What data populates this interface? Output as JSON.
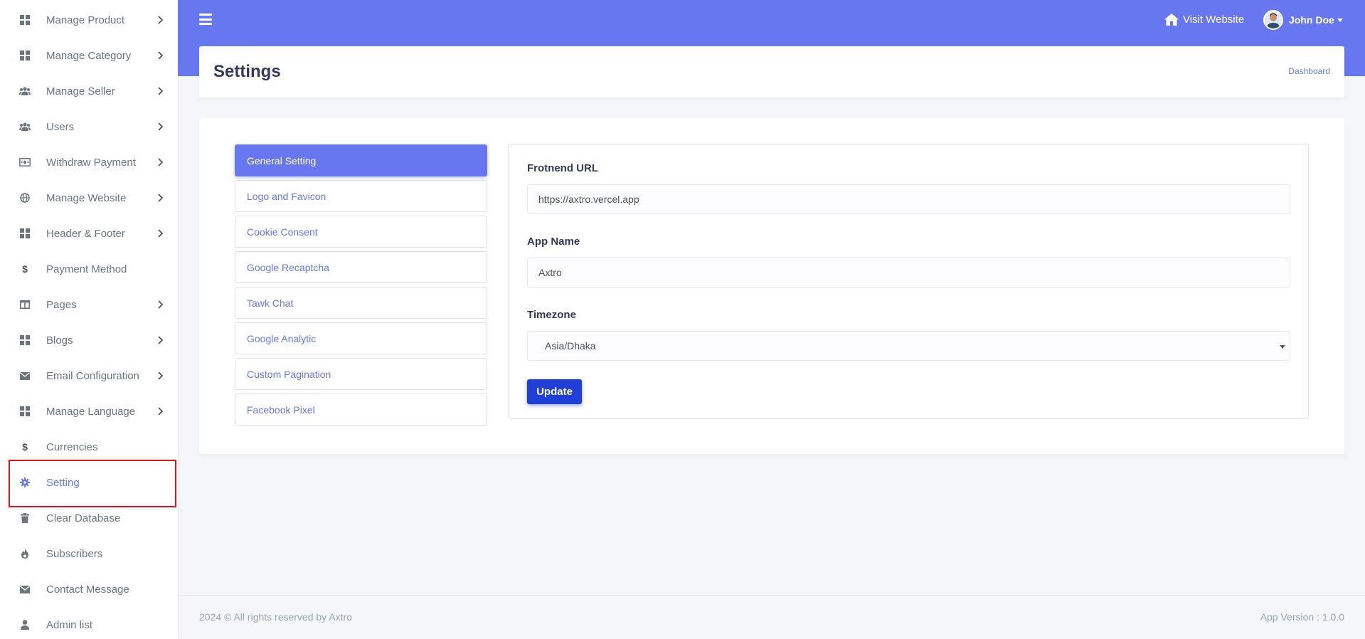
{
  "sidebar": {
    "items": [
      {
        "label": "Manage Product",
        "icon": "grid-icon",
        "chevron": true
      },
      {
        "label": "Manage Category",
        "icon": "grid-icon",
        "chevron": true
      },
      {
        "label": "Manage Seller",
        "icon": "users-icon",
        "chevron": true
      },
      {
        "label": "Users",
        "icon": "users-icon",
        "chevron": true
      },
      {
        "label": "Withdraw Payment",
        "icon": "money-card-icon",
        "chevron": true
      },
      {
        "label": "Manage Website",
        "icon": "globe-icon",
        "chevron": true
      },
      {
        "label": "Header & Footer",
        "icon": "grid-icon",
        "chevron": true
      },
      {
        "label": "Payment Method",
        "icon": "dollar-icon",
        "chevron": false
      },
      {
        "label": "Pages",
        "icon": "columns-icon",
        "chevron": true
      },
      {
        "label": "Blogs",
        "icon": "grid-icon",
        "chevron": true
      },
      {
        "label": "Email Configuration",
        "icon": "envelope-icon",
        "chevron": true
      },
      {
        "label": "Manage Language",
        "icon": "grid-icon",
        "chevron": true
      },
      {
        "label": "Currencies",
        "icon": "dollar-icon",
        "chevron": false
      },
      {
        "label": "Setting",
        "icon": "gear-icon",
        "chevron": false,
        "active": true
      },
      {
        "label": "Clear Database",
        "icon": "trash-icon",
        "chevron": false
      },
      {
        "label": "Subscribers",
        "icon": "fire-icon",
        "chevron": false
      },
      {
        "label": "Contact Message",
        "icon": "envelope-icon",
        "chevron": false
      },
      {
        "label": "Admin list",
        "icon": "user-icon",
        "chevron": false
      }
    ]
  },
  "topbar": {
    "menu_icon": "hamburger-icon",
    "visit_website": "Visit Website",
    "user_name": "John Doe"
  },
  "header": {
    "title": "Settings",
    "breadcrumb": "Dashboard"
  },
  "settings_tabs": [
    {
      "label": "General Setting",
      "active": true
    },
    {
      "label": "Logo and Favicon"
    },
    {
      "label": "Cookie Consent"
    },
    {
      "label": "Google Recaptcha"
    },
    {
      "label": "Tawk Chat"
    },
    {
      "label": "Google Analytic"
    },
    {
      "label": "Custom Pagination"
    },
    {
      "label": "Facebook Pixel"
    }
  ],
  "form": {
    "frontend_url_label": "Frotnend URL",
    "frontend_url_value": "https://axtro.vercel.app",
    "app_name_label": "App Name",
    "app_name_value": "Axtro",
    "timezone_label": "Timezone",
    "timezone_value": "Asia/Dhaka",
    "update_label": "Update"
  },
  "footer": {
    "copyright": "2024 © All rights reserved by Axtro",
    "version": "App Version : 1.0.0"
  },
  "colors": {
    "primary": "#6777ef",
    "button": "#1f3fd6",
    "highlight": "#e8101a"
  }
}
